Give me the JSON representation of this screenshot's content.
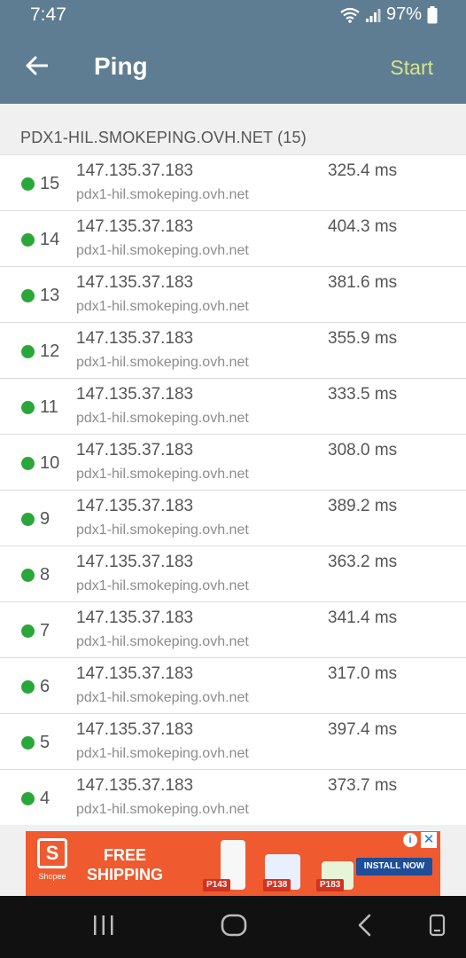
{
  "status_bar": {
    "time": "7:47",
    "battery": "97%"
  },
  "app_bar": {
    "title": "Ping",
    "start_label": "Start"
  },
  "target": {
    "header": "PDX1-HIL.SMOKEPING.OVH.NET (15)"
  },
  "hops": [
    {
      "num": "15",
      "ip": "147.135.37.183",
      "host": "pdx1-hil.smokeping.ovh.net",
      "time": "325.4 ms"
    },
    {
      "num": "14",
      "ip": "147.135.37.183",
      "host": "pdx1-hil.smokeping.ovh.net",
      "time": "404.3 ms"
    },
    {
      "num": "13",
      "ip": "147.135.37.183",
      "host": "pdx1-hil.smokeping.ovh.net",
      "time": "381.6 ms"
    },
    {
      "num": "12",
      "ip": "147.135.37.183",
      "host": "pdx1-hil.smokeping.ovh.net",
      "time": "355.9 ms"
    },
    {
      "num": "11",
      "ip": "147.135.37.183",
      "host": "pdx1-hil.smokeping.ovh.net",
      "time": "333.5 ms"
    },
    {
      "num": "10",
      "ip": "147.135.37.183",
      "host": "pdx1-hil.smokeping.ovh.net",
      "time": "308.0 ms"
    },
    {
      "num": "9",
      "ip": "147.135.37.183",
      "host": "pdx1-hil.smokeping.ovh.net",
      "time": "389.2 ms"
    },
    {
      "num": "8",
      "ip": "147.135.37.183",
      "host": "pdx1-hil.smokeping.ovh.net",
      "time": "363.2 ms"
    },
    {
      "num": "7",
      "ip": "147.135.37.183",
      "host": "pdx1-hil.smokeping.ovh.net",
      "time": "341.4 ms"
    },
    {
      "num": "6",
      "ip": "147.135.37.183",
      "host": "pdx1-hil.smokeping.ovh.net",
      "time": "317.0 ms"
    },
    {
      "num": "5",
      "ip": "147.135.37.183",
      "host": "pdx1-hil.smokeping.ovh.net",
      "time": "397.4 ms"
    },
    {
      "num": "4",
      "ip": "147.135.37.183",
      "host": "pdx1-hil.smokeping.ovh.net",
      "time": "373.7 ms"
    }
  ],
  "ad": {
    "brand": "Shopee",
    "logo_letter": "S",
    "headline_line1": "FREE",
    "headline_line2": "SHIPPING",
    "price1": "P143",
    "price2": "P138",
    "price3": "P183",
    "cta": "INSTALL NOW"
  },
  "colors": {
    "app_bar": "#5e7d92",
    "start": "#d5e68a",
    "status_dot": "#2aa73a",
    "ad_bg": "#ef5a2f"
  }
}
